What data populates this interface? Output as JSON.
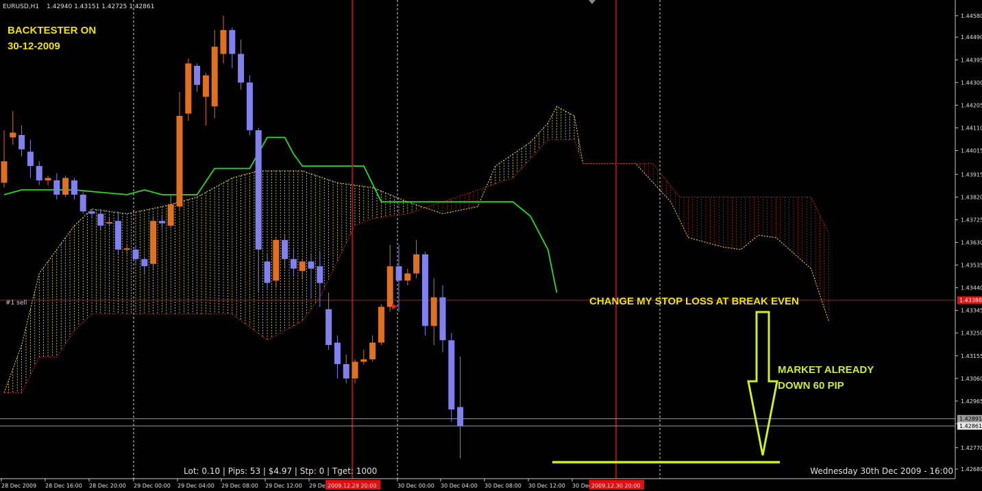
{
  "header": {
    "symbol": "EURUSD,H1",
    "ohlc": "1.42940 1.43151 1.42725 1.42861"
  },
  "annotations": {
    "backtester_line1": "BACKTESTER ON",
    "backtester_line2": "30-12-2009",
    "stop_loss_note": "CHANGE MY STOP LOSS AT BREAK EVEN",
    "market_line1": "MARKET ALREADY",
    "market_line2": "DOWN 60 PIP",
    "order_label": "#1 sell",
    "stats": "Lot: 0.10 | Pips: 53 | $4.97 | Stp: 0 | Tget: 1000",
    "datetime": "Wednesday 30th Dec 2009 - 16:00"
  },
  "colors": {
    "background": "#000000",
    "bull": "#e07020",
    "bear": "#8080f0",
    "kijun": "#22dd22",
    "senkou_a": "#f2e640",
    "senkou_b": "#c0221a",
    "order_line": "#cc1111",
    "annotation_yellow": "#f2e200",
    "annotation_green": "#ccee22"
  },
  "chart_data": {
    "type": "candlestick",
    "symbol": "EURUSD",
    "timeframe": "H1",
    "ylim": [
      1.4264,
      1.4464
    ],
    "y_ticks": [
      "1.44580",
      "1.44490",
      "1.44395",
      "1.44300",
      "1.44205",
      "1.44110",
      "1.44015",
      "1.43915",
      "1.43820",
      "1.43725",
      "1.43630",
      "1.43535",
      "1.43440",
      "1.43345",
      "1.43250",
      "1.43155",
      "1.43060",
      "1.42965",
      "1.42870",
      "1.42770",
      "1.42680"
    ],
    "x_ticks": [
      "28 Dec 2009",
      "28 Dec 16:00",
      "28 Dec 20:00",
      "29 Dec 00:00",
      "29 Dec 04:00",
      "29 Dec 08:00",
      "29 Dec 12:00",
      "29 Dec",
      "30 Dec 00:00",
      "30 Dec 04:00",
      "30 Dec 08:00",
      "30 Dec 12:00",
      "30 Dec"
    ],
    "cursor_labels": [
      "2009.12.29 20:00",
      "2009.12.30 20:00"
    ],
    "price_tags": {
      "order": "1.43388",
      "ask": "1.42891",
      "bid": "1.42861"
    },
    "order_price": 1.43388,
    "ask_price": 1.42891,
    "bid_price": 1.42861,
    "candles": [
      {
        "o": 1.4388,
        "h": 1.441,
        "c": 1.4397,
        "l": 1.4386
      },
      {
        "o": 1.4407,
        "h": 1.4418,
        "c": 1.4409,
        "l": 1.4404
      },
      {
        "o": 1.4408,
        "h": 1.4412,
        "c": 1.4402,
        "l": 1.4399
      },
      {
        "o": 1.4401,
        "h": 1.4406,
        "c": 1.4395,
        "l": 1.439
      },
      {
        "o": 1.4395,
        "h": 1.4397,
        "c": 1.4389,
        "l": 1.4387
      },
      {
        "o": 1.4389,
        "h": 1.4391,
        "c": 1.439,
        "l": 1.4387
      },
      {
        "o": 1.4389,
        "h": 1.4392,
        "c": 1.4383,
        "l": 1.4381
      },
      {
        "o": 1.4383,
        "h": 1.4391,
        "c": 1.439,
        "l": 1.4382
      },
      {
        "o": 1.4389,
        "h": 1.439,
        "c": 1.4383,
        "l": 1.4381
      },
      {
        "o": 1.4383,
        "h": 1.4384,
        "c": 1.4376,
        "l": 1.4375
      },
      {
        "o": 1.4376,
        "h": 1.4377,
        "c": 1.4375,
        "l": 1.4373
      },
      {
        "o": 1.4375,
        "h": 1.4377,
        "c": 1.437,
        "l": 1.4368
      },
      {
        "o": 1.4371,
        "h": 1.4373,
        "c": 1.43715,
        "l": 1.437
      },
      {
        "o": 1.4372,
        "h": 1.4376,
        "c": 1.436,
        "l": 1.4358
      },
      {
        "o": 1.436,
        "h": 1.4362,
        "c": 1.43605,
        "l": 1.4358
      },
      {
        "o": 1.436,
        "h": 1.4362,
        "c": 1.4356,
        "l": 1.4354
      },
      {
        "o": 1.4356,
        "h": 1.4357,
        "c": 1.4353,
        "l": 1.435
      },
      {
        "o": 1.4354,
        "h": 1.4374,
        "c": 1.4372,
        "l": 1.4352
      },
      {
        "o": 1.4372,
        "h": 1.4374,
        "c": 1.4371,
        "l": 1.4369
      },
      {
        "o": 1.437,
        "h": 1.4383,
        "c": 1.4379,
        "l": 1.4369
      },
      {
        "o": 1.4378,
        "h": 1.4426,
        "c": 1.4416,
        "l": 1.4376
      },
      {
        "o": 1.4417,
        "h": 1.444,
        "c": 1.4438,
        "l": 1.4414
      },
      {
        "o": 1.4437,
        "h": 1.4438,
        "c": 1.4429,
        "l": 1.4426
      },
      {
        "o": 1.4424,
        "h": 1.4434,
        "c": 1.4433,
        "l": 1.4412
      },
      {
        "o": 1.442,
        "h": 1.4452,
        "c": 1.4445,
        "l": 1.4415
      },
      {
        "o": 1.4442,
        "h": 1.4458,
        "c": 1.4452,
        "l": 1.4438
      },
      {
        "o": 1.4452,
        "h": 1.4453,
        "c": 1.4442,
        "l": 1.4436
      },
      {
        "o": 1.4442,
        "h": 1.4448,
        "c": 1.443,
        "l": 1.4427
      },
      {
        "o": 1.443,
        "h": 1.4433,
        "c": 1.441,
        "l": 1.4408
      },
      {
        "o": 1.441,
        "h": 1.4411,
        "c": 1.436,
        "l": 1.4342
      },
      {
        "o": 1.4355,
        "h": 1.4358,
        "c": 1.4346,
        "l": 1.4343
      },
      {
        "o": 1.4347,
        "h": 1.4365,
        "c": 1.4364,
        "l": 1.4344
      },
      {
        "o": 1.4364,
        "h": 1.4366,
        "c": 1.4356,
        "l": 1.4352
      },
      {
        "o": 1.4356,
        "h": 1.436,
        "c": 1.4352,
        "l": 1.4349
      },
      {
        "o": 1.4351,
        "h": 1.4356,
        "c": 1.4355,
        "l": 1.4348
      },
      {
        "o": 1.4355,
        "h": 1.4358,
        "c": 1.4352,
        "l": 1.434
      },
      {
        "o": 1.4353,
        "h": 1.4359,
        "c": 1.4346,
        "l": 1.4336
      },
      {
        "o": 1.4335,
        "h": 1.4342,
        "c": 1.432,
        "l": 1.4318
      },
      {
        "o": 1.4321,
        "h": 1.4324,
        "c": 1.4312,
        "l": 1.4306
      },
      {
        "o": 1.4312,
        "h": 1.4316,
        "c": 1.4306,
        "l": 1.4304
      },
      {
        "o": 1.4306,
        "h": 1.4314,
        "c": 1.4313,
        "l": 1.4304
      },
      {
        "o": 1.4313,
        "h": 1.4318,
        "c": 1.4314,
        "l": 1.4312
      },
      {
        "o": 1.4314,
        "h": 1.4324,
        "c": 1.4321,
        "l": 1.4313
      },
      {
        "o": 1.4321,
        "h": 1.4337,
        "c": 1.4336,
        "l": 1.432
      },
      {
        "o": 1.4336,
        "h": 1.4362,
        "c": 1.4353,
        "l": 1.4334
      },
      {
        "o": 1.4353,
        "h": 1.4362,
        "c": 1.4347,
        "l": 1.4334
      },
      {
        "o": 1.4347,
        "h": 1.4352,
        "c": 1.435,
        "l": 1.4345
      },
      {
        "o": 1.435,
        "h": 1.4364,
        "c": 1.4358,
        "l": 1.4348
      },
      {
        "o": 1.4358,
        "h": 1.4359,
        "c": 1.4328,
        "l": 1.4324
      },
      {
        "o": 1.4328,
        "h": 1.4348,
        "c": 1.434,
        "l": 1.432
      },
      {
        "o": 1.434,
        "h": 1.4345,
        "c": 1.4322,
        "l": 1.4317
      },
      {
        "o": 1.4322,
        "h": 1.4325,
        "c": 1.4293,
        "l": 1.4288
      },
      {
        "o": 1.4294,
        "h": 1.43151,
        "c": 1.42861,
        "l": 1.42725
      }
    ],
    "kijun": [
      [
        0,
        1.4383
      ],
      [
        2,
        1.4385
      ],
      [
        8,
        1.4385
      ],
      [
        14,
        1.4383
      ],
      [
        16,
        1.4385
      ],
      [
        18,
        1.4383
      ],
      [
        22,
        1.4383
      ],
      [
        24,
        1.4394
      ],
      [
        28,
        1.4394
      ],
      [
        30,
        1.4407
      ],
      [
        32,
        1.4407
      ],
      [
        33,
        1.44
      ],
      [
        34,
        1.4395
      ],
      [
        41,
        1.4395
      ],
      [
        43,
        1.438
      ],
      [
        58,
        1.438
      ],
      [
        60,
        1.4374
      ],
      [
        62,
        1.436
      ],
      [
        63,
        1.4342
      ]
    ],
    "senkou_a": [
      [
        0,
        1.43
      ],
      [
        2,
        1.432
      ],
      [
        4,
        1.435
      ],
      [
        6,
        1.436
      ],
      [
        8,
        1.437
      ],
      [
        10,
        1.4377
      ],
      [
        14,
        1.4375
      ],
      [
        18,
        1.4378
      ],
      [
        22,
        1.4382
      ],
      [
        26,
        1.439
      ],
      [
        29,
        1.4393
      ],
      [
        34,
        1.4393
      ],
      [
        38,
        1.4388
      ],
      [
        42,
        1.4386
      ],
      [
        46,
        1.438
      ],
      [
        50,
        1.4375
      ],
      [
        54,
        1.4378
      ],
      [
        56,
        1.4395
      ],
      [
        60,
        1.4405
      ],
      [
        62,
        1.4413
      ],
      [
        63,
        1.442
      ],
      [
        65,
        1.4416
      ],
      [
        66,
        1.4396
      ],
      [
        72,
        1.4396
      ],
      [
        76,
        1.438
      ],
      [
        78,
        1.4365
      ],
      [
        82,
        1.4361
      ],
      [
        84,
        1.436
      ],
      [
        86,
        1.4366
      ],
      [
        88,
        1.4365
      ],
      [
        92,
        1.4352
      ],
      [
        94,
        1.433
      ]
    ],
    "senkou_b": [
      [
        0,
        1.43
      ],
      [
        2,
        1.43
      ],
      [
        4,
        1.4315
      ],
      [
        6,
        1.4315
      ],
      [
        8,
        1.4326
      ],
      [
        10,
        1.4333
      ],
      [
        24,
        1.4333
      ],
      [
        26,
        1.4333
      ],
      [
        30,
        1.4322
      ],
      [
        34,
        1.433
      ],
      [
        36,
        1.434
      ],
      [
        40,
        1.437
      ],
      [
        42,
        1.4373
      ],
      [
        46,
        1.4375
      ],
      [
        50,
        1.438
      ],
      [
        54,
        1.4385
      ],
      [
        58,
        1.439
      ],
      [
        62,
        1.4406
      ],
      [
        65,
        1.4406
      ],
      [
        66,
        1.4396
      ],
      [
        74,
        1.4396
      ],
      [
        77,
        1.4382
      ],
      [
        80,
        1.4382
      ],
      [
        92,
        1.4382
      ],
      [
        94,
        1.4367
      ]
    ]
  }
}
